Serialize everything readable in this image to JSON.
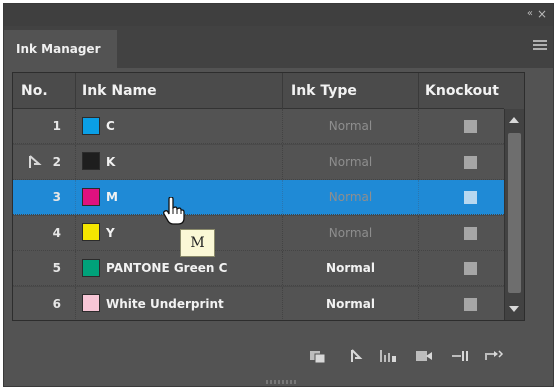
{
  "panel": {
    "tab_label": "Ink Manager",
    "collapse_glyph": "«",
    "close_glyph": "×"
  },
  "table": {
    "headers": {
      "no": "No.",
      "name": "Ink Name",
      "type": "Ink Type",
      "knockout": "Knockout"
    },
    "rows": [
      {
        "no": "1",
        "name": "C",
        "type": "Normal",
        "swatch": "#0a9fe6",
        "type_dim": true,
        "selected": false
      },
      {
        "no": "2",
        "name": "K",
        "type": "Normal",
        "swatch": "#1e1e1e",
        "type_dim": true,
        "selected": false,
        "has_pen": true
      },
      {
        "no": "3",
        "name": "M",
        "type": "Normal",
        "swatch": "#e0117f",
        "type_dim": true,
        "selected": true
      },
      {
        "no": "4",
        "name": "Y",
        "type": "Normal",
        "swatch": "#f5e600",
        "type_dim": true,
        "selected": false
      },
      {
        "no": "5",
        "name": "PANTONE Green C",
        "type": "Normal",
        "swatch": "#00a27a",
        "type_dim": false,
        "selected": false
      },
      {
        "no": "6",
        "name": "White Underprint",
        "type": "Normal",
        "swatch": "#f7c6d6",
        "type_dim": false,
        "selected": false
      }
    ]
  },
  "tooltip": {
    "text": "M"
  },
  "footer": {
    "icons": [
      "new-ink-icon",
      "pen-icon",
      "bar-chart-icon",
      "ink-settings-icon",
      "split-icon",
      "merge-icon"
    ]
  },
  "colors": {
    "panel_bg": "#535353",
    "selected_row": "#1f8ad6",
    "tooltip_bg": "#fbf8d6"
  }
}
